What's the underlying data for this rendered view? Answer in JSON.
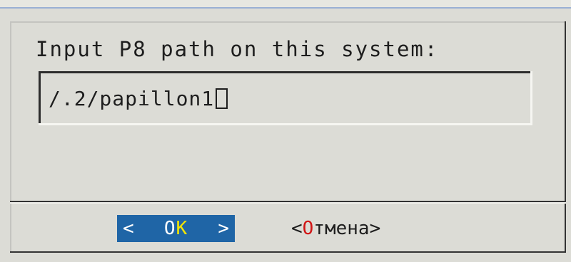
{
  "dialog": {
    "prompt": "Input P8 path on this system:",
    "input": {
      "value": "/.2/papillon1"
    },
    "buttons": {
      "ok": {
        "left_bracket": "<",
        "label_prefix": "O",
        "hotkey": "K",
        "right_bracket": ">"
      },
      "cancel": {
        "left_bracket": "<",
        "hotkey": "О",
        "label_rest": "тмена",
        "right_bracket": ">"
      }
    }
  },
  "colors": {
    "background": "#dcdcd6",
    "selected_button": "#1f65a6",
    "hotkey_selected": "#f4e500",
    "hotkey_unselected": "#d11515"
  }
}
